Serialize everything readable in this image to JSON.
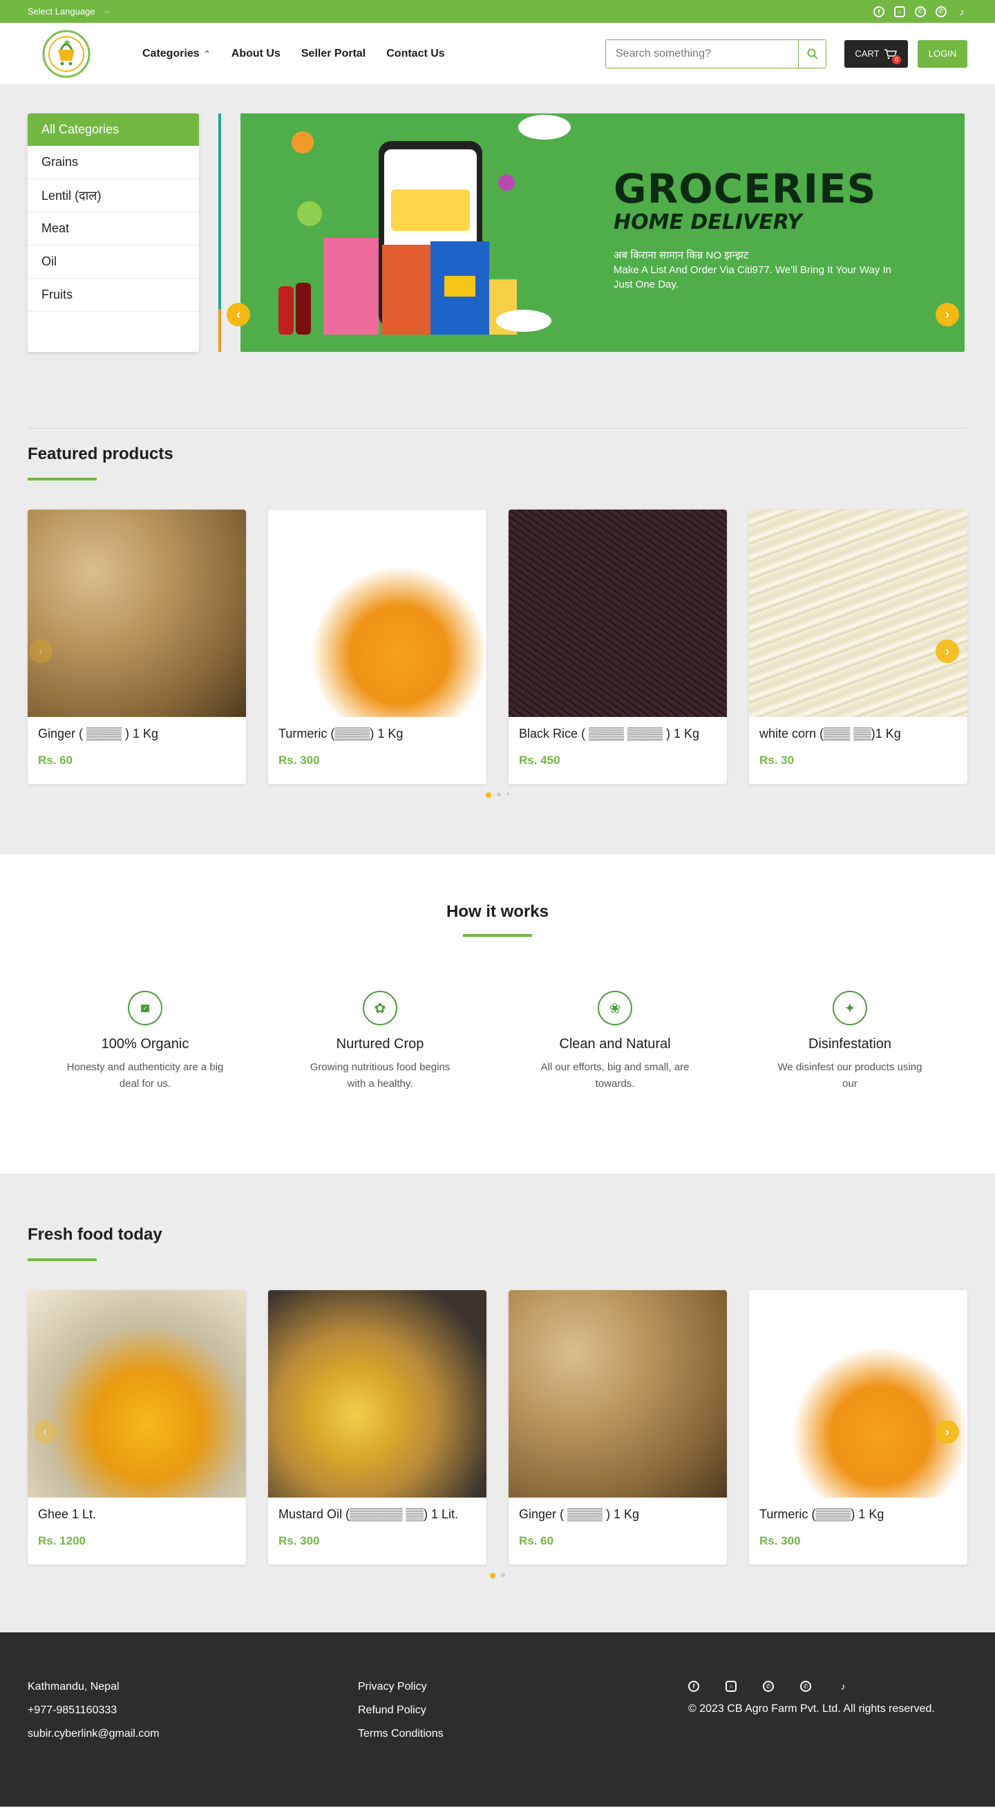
{
  "topbar": {
    "language_label": "Select Language",
    "social": [
      "facebook-icon",
      "instagram-icon",
      "whatsapp-icon",
      "viber-icon",
      "tiktok-icon"
    ]
  },
  "header": {
    "logo_alt": "CB Agro Farm",
    "nav": [
      {
        "label": "Categories"
      },
      {
        "label": "About Us"
      },
      {
        "label": "Seller Portal"
      },
      {
        "label": "Contact Us"
      }
    ],
    "search_placeholder": "Search something?",
    "cart_label": "CART",
    "cart_count": "0",
    "login_label": "LOGIN"
  },
  "categories": {
    "title": "All Categories",
    "items": [
      "Grains",
      "Lentil (दाल)",
      "Meat",
      "Oil",
      "Fruits"
    ]
  },
  "banner": {
    "headline": "GROCERIES",
    "subheadline": "HOME DELIVERY",
    "line1": "अब किराना सामान किन्न NO झन्झट",
    "line2": "Make A List And Order Via Citi977. We'll Bring It Your Way In Just One Day."
  },
  "featured": {
    "title": "Featured products",
    "products": [
      {
        "name": "Ginger ( ▒▒▒▒ ) 1 Kg",
        "price": "Rs. 60"
      },
      {
        "name": "Turmeric (▒▒▒▒) 1 Kg",
        "price": "Rs. 300"
      },
      {
        "name": "Black Rice ( ▒▒▒▒ ▒▒▒▒ ) 1 Kg",
        "price": "Rs. 450"
      },
      {
        "name": "white corn (▒▒▒ ▒▒)1 Kg",
        "price": "Rs. 30"
      }
    ]
  },
  "how": {
    "title": "How it works",
    "features": [
      {
        "icon": "certified-badge-icon",
        "title": "100% Organic",
        "desc": "Honesty and authenticity are a big deal for us."
      },
      {
        "icon": "hand-leaf-icon",
        "title": "Nurtured Crop",
        "desc": "Growing nutritious food begins with a healthy."
      },
      {
        "icon": "plant-circle-icon",
        "title": "Clean and Natural",
        "desc": "All our efforts, big and small, are towards."
      },
      {
        "icon": "sparkle-icon",
        "title": "Disinfestation",
        "desc": "We disinfest our products using our"
      }
    ]
  },
  "fresh": {
    "title": "Fresh food today",
    "products": [
      {
        "name": "Ghee 1 Lt.",
        "price": "Rs. 1200"
      },
      {
        "name": "Mustard Oil (▒▒▒▒▒▒ ▒▒) 1 Lit.",
        "price": "Rs. 300"
      },
      {
        "name": "Ginger ( ▒▒▒▒ ) 1 Kg",
        "price": "Rs. 60"
      },
      {
        "name": "Turmeric (▒▒▒▒) 1 Kg",
        "price": "Rs. 300"
      }
    ]
  },
  "footer": {
    "contact": [
      "Kathmandu, Nepal",
      "+977-9851160333",
      "subir.cyberlink@gmail.com"
    ],
    "links": [
      "Privacy Policy",
      "Refund Policy",
      "Terms Conditions"
    ],
    "copyright": "© 2023 CB Agro Farm Pvt. Ltd. All rights reserved."
  },
  "colors": {
    "brand_green": "#72b843",
    "accent_yellow": "#f5b913",
    "footer_bg": "#2d2d2d"
  }
}
